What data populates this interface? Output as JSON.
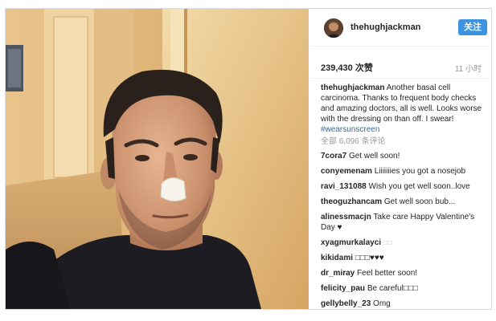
{
  "post": {
    "username": "thehughjackman",
    "follow_label": "关注",
    "likes": "239,430 次赞",
    "time": "11 小时",
    "caption_user": "thehughjackman",
    "caption_text": "Another basal cell carcinoma. Thanks to frequent body checks and amazing doctors, all is well. Looks worse with the dressing on than off. I swear!",
    "caption_tag": "#wearsunscreen",
    "view_all": "全部 6,096 条评论"
  },
  "comments": [
    {
      "user": "7cora7",
      "text": "Get well soon!"
    },
    {
      "user": "conyemenam",
      "text": "Liiiiiiies you got a nosejob"
    },
    {
      "user": "ravi_131088",
      "text": "Wish you get well soon..love"
    },
    {
      "user": "theoguzhancam",
      "text": "Get well soon bub..."
    },
    {
      "user": "alinessmacjn",
      "text": "Take care Happy Valentine's Day ♥"
    },
    {
      "user": "xyagmurkalayci",
      "text": "□□"
    },
    {
      "user": "kikidami",
      "text": "□□□♥♥♥"
    },
    {
      "user": "dr_miray",
      "text": "Feel better soon!"
    },
    {
      "user": "felicity_pau",
      "text": "Be careful□□□"
    },
    {
      "user": "gellybelly_23",
      "text": "Omg"
    }
  ],
  "colors": {
    "follow_button": "#3e93e0",
    "hashtag": "#3a6a9a",
    "muted_text": "#999999"
  },
  "icons": {
    "avatar": "profile-photo"
  }
}
